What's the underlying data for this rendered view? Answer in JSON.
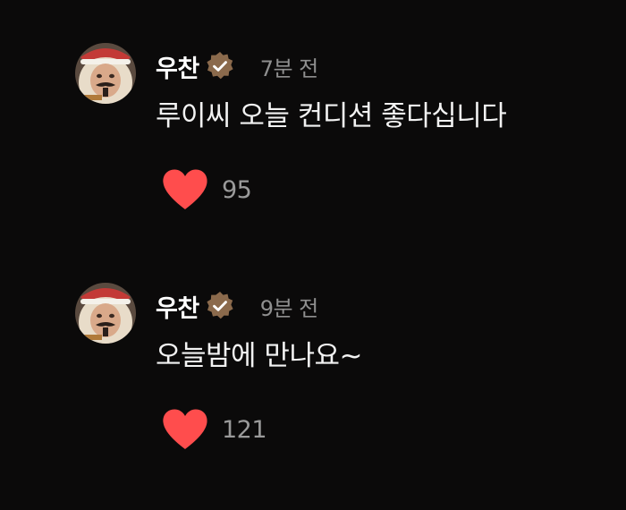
{
  "colors": {
    "background": "#0b0a0a",
    "heart": "#ff4d4d",
    "verified_badge": "#8b6a4c",
    "timestamp": "#8f8f8f"
  },
  "comments": [
    {
      "username": "우찬",
      "verified": true,
      "timestamp": "7분 전",
      "text": "루이씨 오늘 컨디션 좋다십니다",
      "likes": "95",
      "icons": {
        "avatar": "avatar-photo",
        "badge": "verified-check-icon",
        "like": "heart-icon"
      }
    },
    {
      "username": "우찬",
      "verified": true,
      "timestamp": "9분 전",
      "text": "오늘밤에 만나요~",
      "likes": "121",
      "icons": {
        "avatar": "avatar-photo",
        "badge": "verified-check-icon",
        "like": "heart-icon"
      }
    }
  ]
}
